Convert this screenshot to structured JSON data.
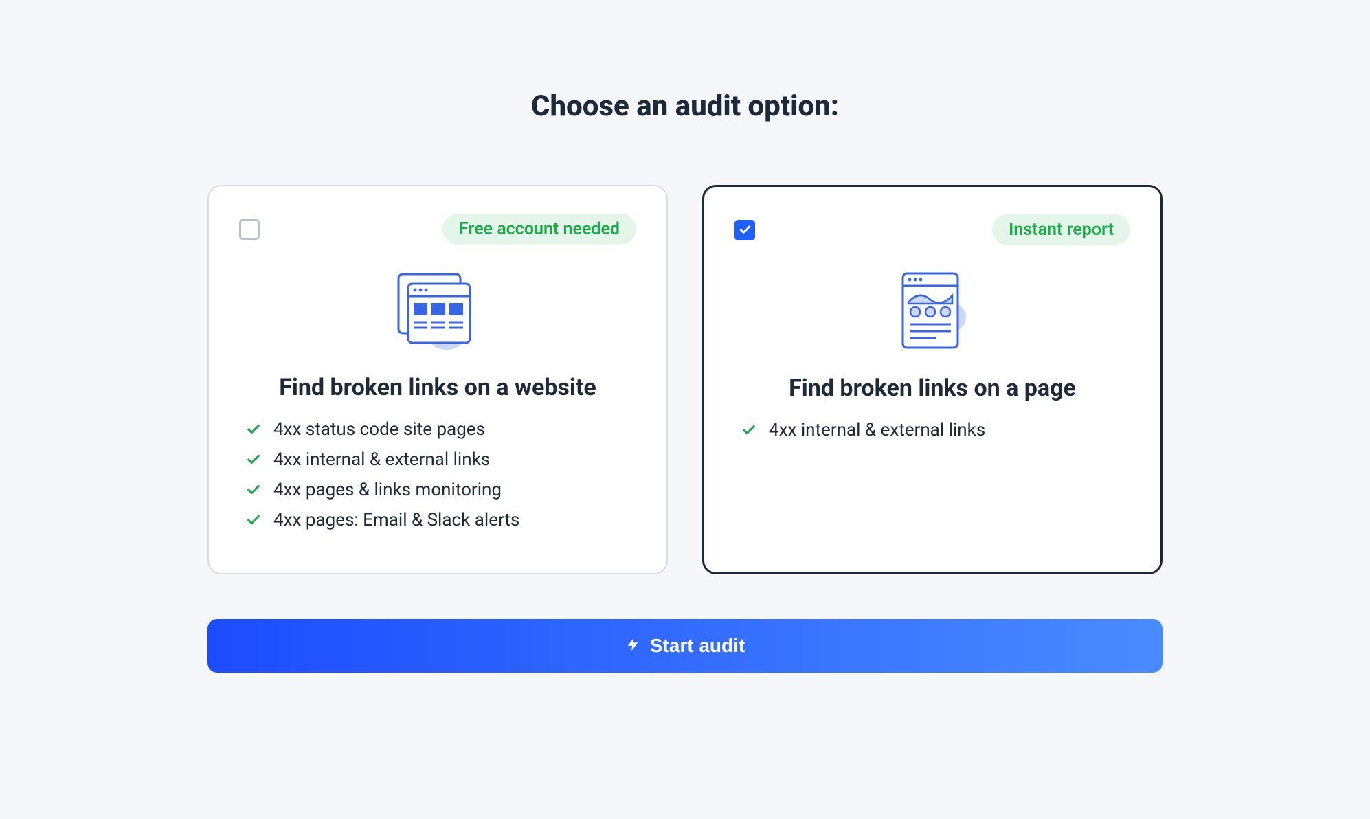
{
  "title": "Choose an audit option:",
  "options": [
    {
      "selected": false,
      "badge": "Free account needed",
      "title": "Find broken links on a website",
      "features": [
        "4xx status code site pages",
        "4xx internal & external links",
        "4xx pages & links monitoring",
        "4xx pages: Email & Slack alerts"
      ]
    },
    {
      "selected": true,
      "badge": "Instant report",
      "title": "Find broken links on a page",
      "features": [
        "4xx internal & external links"
      ]
    }
  ],
  "cta": "Start audit"
}
